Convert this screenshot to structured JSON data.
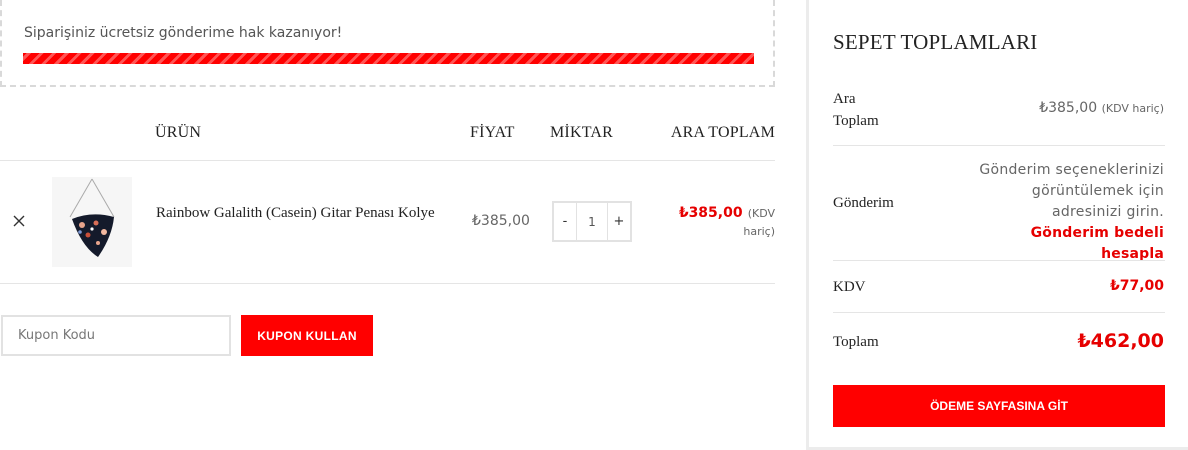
{
  "notice": {
    "text": "Siparişiniz ücretsiz gönderime hak kazanıyor!",
    "progress_percent": 100,
    "accent_color": "#ff0000"
  },
  "table": {
    "headers": {
      "product": "ÜRÜN",
      "price": "FİYAT",
      "quantity": "MİKTAR",
      "subtotal": "ARA TOPLAM"
    },
    "rows": [
      {
        "remove_icon": "close-icon",
        "name": "Rainbow Galalith (Casein) Gitar Penası Kolye",
        "price": "₺385,00",
        "quantity": "1",
        "minus": "-",
        "plus": "+",
        "subtotal": "₺385,00",
        "tax_note": "(KDV",
        "tax_note2": "hariç)"
      }
    ]
  },
  "coupon": {
    "placeholder": "Kupon Kodu",
    "button_label": "KUPON KULLAN"
  },
  "totals": {
    "title": "SEPET TOPLAMLARI",
    "subtotal_label_1": "Ara",
    "subtotal_label_2": "Toplam",
    "subtotal_value": "₺385,00",
    "subtotal_tax_note": "(KDV hariç)",
    "shipping_label": "Gönderim",
    "shipping_text": "Gönderim seçeneklerinizi görüntülemek için adresinizi girin.",
    "shipping_link": "Gönderim bedeli hesapla",
    "tax_label": "KDV",
    "tax_value": "₺77,00",
    "total_label": "Toplam",
    "total_value": "₺462,00",
    "checkout_label": "ÖDEME SAYFASINA GİT"
  }
}
